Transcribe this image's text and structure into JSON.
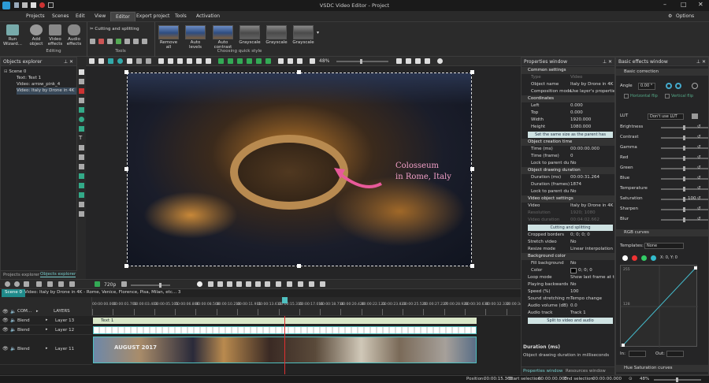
{
  "app": {
    "title": "VSDC Video Editor - Project"
  },
  "menu": {
    "items": [
      "Projects",
      "Scenes",
      "Edit",
      "View",
      "Editor",
      "Export project",
      "Tools",
      "Activation"
    ],
    "active": "Editor",
    "options": "Options"
  },
  "ribbon": {
    "run_wizard": "Run Wizard...",
    "add_object": "Add object",
    "video_effects": "Video effects",
    "audio_effects": "Audio effects",
    "editing_label": "Editing",
    "cutting_splitting": "Cutting and splitting",
    "tools_label": "Tools",
    "quick_styles": [
      "Remove all",
      "Auto levels",
      "Auto contrast",
      "Grayscale",
      "Grayscale",
      "Grayscale"
    ],
    "quick_style_label": "Choosing quick style"
  },
  "objects_explorer": {
    "title": "Objects explorer",
    "tree": [
      {
        "label": "Scene 0",
        "level": 0
      },
      {
        "label": "Text: Text 1",
        "level": 1
      },
      {
        "label": "Video: arrow_pink_4",
        "level": 1
      },
      {
        "label": "Video: Italy by Drone in 4K",
        "level": 1
      }
    ],
    "tabs": [
      "Projects explorer",
      "Objects explorer"
    ]
  },
  "preview": {
    "zoom": "48%",
    "overlay_text_line1": "Colosseum",
    "overlay_text_line2": "in Rome, Italy"
  },
  "properties": {
    "title": "Properties window",
    "common_settings": "Common settings",
    "type_key": "Type",
    "type_val": "Video",
    "object_name_key": "Object name",
    "object_name_val": "Italy by Drone in 4K - F",
    "composition_key": "Composition mode",
    "composition_val": "Use layer's properties",
    "coordinates": "Coordinates",
    "left_key": "Left",
    "left_val": "0.000",
    "top_key": "Top",
    "top_val": "0.000",
    "width_key": "Width",
    "width_val": "1920.000",
    "height_key": "Height",
    "height_val": "1080.000",
    "set_parent_btn": "Set the same size as the parent has",
    "creation_time": "Object creation time",
    "time_ms_key": "Time (ms)",
    "time_ms_val": "00:00:00.000",
    "time_frame_key": "Time (frame)",
    "time_frame_val": "0",
    "lock_parent_key": "Lock to parent du",
    "lock_parent_val": "No",
    "drawing_duration": "Object drawing duration",
    "duration_ms_key": "Duration (ms)",
    "duration_ms_val": "00:00:31.264",
    "duration_frames_key": "Duration (frames)",
    "duration_frames_val": "1874",
    "lock_parent2_key": "Lock to parent du",
    "lock_parent2_val": "No",
    "video_settings": "Video object settings",
    "video_key": "Video",
    "video_val": "Italy by Drone in 4K -",
    "resolution_key": "Resolution",
    "resolution_val": "1920; 1080",
    "vid_duration_key": "Video duration",
    "vid_duration_val": "00:04:02.662",
    "cutting_btn": "Cutting and splitting",
    "cropped_key": "Cropped borders",
    "cropped_val": "0; 0; 0; 0",
    "stretch_key": "Stretch video",
    "stretch_val": "No",
    "resize_key": "Resize mode",
    "resize_val": "Linear interpolation",
    "bg_color": "Background color",
    "fill_bg_key": "Fill background",
    "fill_bg_val": "No",
    "color_key": "Color",
    "color_val": "0; 0; 0",
    "loop_key": "Loop mode",
    "loop_val": "Show last frame at the",
    "playing_back_key": "Playing backwards",
    "playing_back_val": "No",
    "speed_key": "Speed (%)",
    "speed_val": "100",
    "sound_stretch_key": "Sound stretching m",
    "sound_stretch_val": "Tempo change",
    "audio_vol_key": "Audio volume (dB)",
    "audio_vol_val": "0.0",
    "audio_track_key": "Audio track",
    "audio_track_val": "Track 1",
    "split_btn": "Split to video and audio",
    "help_title": "Duration (ms)",
    "help_text": "Object drawing duration in milliseconds",
    "tabs": [
      "Properties window",
      "Resources window"
    ]
  },
  "effects": {
    "title": "Basic effects window",
    "basic_correction": "Basic correction",
    "angle_label": "Angle",
    "angle_val": "0.00 °",
    "hflip": "Horizontal flip",
    "vflip": "Vertical flip",
    "lut_label": "LUT",
    "lut_val": "Don't use LUT",
    "sliders": [
      {
        "label": "Brightness",
        "value": ""
      },
      {
        "label": "Contrast",
        "value": ""
      },
      {
        "label": "Gamma",
        "value": ""
      },
      {
        "label": "Red",
        "value": ""
      },
      {
        "label": "Green",
        "value": ""
      },
      {
        "label": "Blue",
        "value": ""
      },
      {
        "label": "Temperature",
        "value": ""
      },
      {
        "label": "Saturation",
        "value": "100"
      },
      {
        "label": "Sharpen",
        "value": ""
      },
      {
        "label": "Blur",
        "value": ""
      }
    ],
    "rgb_curves": "RGB curves",
    "templates_label": "Templates:",
    "templates_val": "None",
    "curve_coords": "X: 0, Y: 0",
    "curve_ticks": [
      "255",
      "128"
    ],
    "in_label": "In:",
    "out_label": "Out:",
    "hue_sat": "Hue Saturation curves"
  },
  "timeline": {
    "resolution": "720p",
    "scene_tab": "Scene 0",
    "breadcrumb": "Video: Italy by Drone in 4K - Rome, Venice, Florence, Pisa, Milan, etc... 3",
    "com_label": "COM...",
    "layers_label": "LAYERS",
    "ruler": [
      "00:00:00.000",
      "00:00:01.701",
      "00:00:03.403",
      "00:00:05.105",
      "00:00:06.806",
      "00:00:08.508",
      "00:00:10.210",
      "00:00:11.911",
      "00:00:13.613",
      "00:00:15.315",
      "00:00:17.016",
      "00:00:18.718",
      "00:00:20.420",
      "00:00:22.121",
      "00:00:23.823",
      "00:00:25.525",
      "00:00:27.227",
      "00:00:28.928",
      "00:00:30.630",
      "00:00:32.332",
      "00:00:34.034"
    ],
    "tracks": [
      {
        "blend": "Blend",
        "layer": "Layer 13",
        "clip": "Text 1"
      },
      {
        "blend": "Blend",
        "layer": "Layer 12",
        "clip": ""
      },
      {
        "blend": "Blend",
        "layer": "Layer 11",
        "clip": ""
      }
    ],
    "clip_caption": "AUGUST 2017"
  },
  "status": {
    "position_label": "Position:",
    "position_val": "00:00:15.365",
    "start_label": "Start selection:",
    "start_val": "00:00:00.000",
    "end_label": "End selection:",
    "end_val": "00:00:00.000",
    "zoom": "48%"
  },
  "colors": {
    "accent": "#1f8a8a",
    "clip_teal": "#4fc0c0",
    "playhead": "#e03030",
    "text_clip": "#d9e7c8",
    "overlay_text": "#f2a0c8"
  }
}
